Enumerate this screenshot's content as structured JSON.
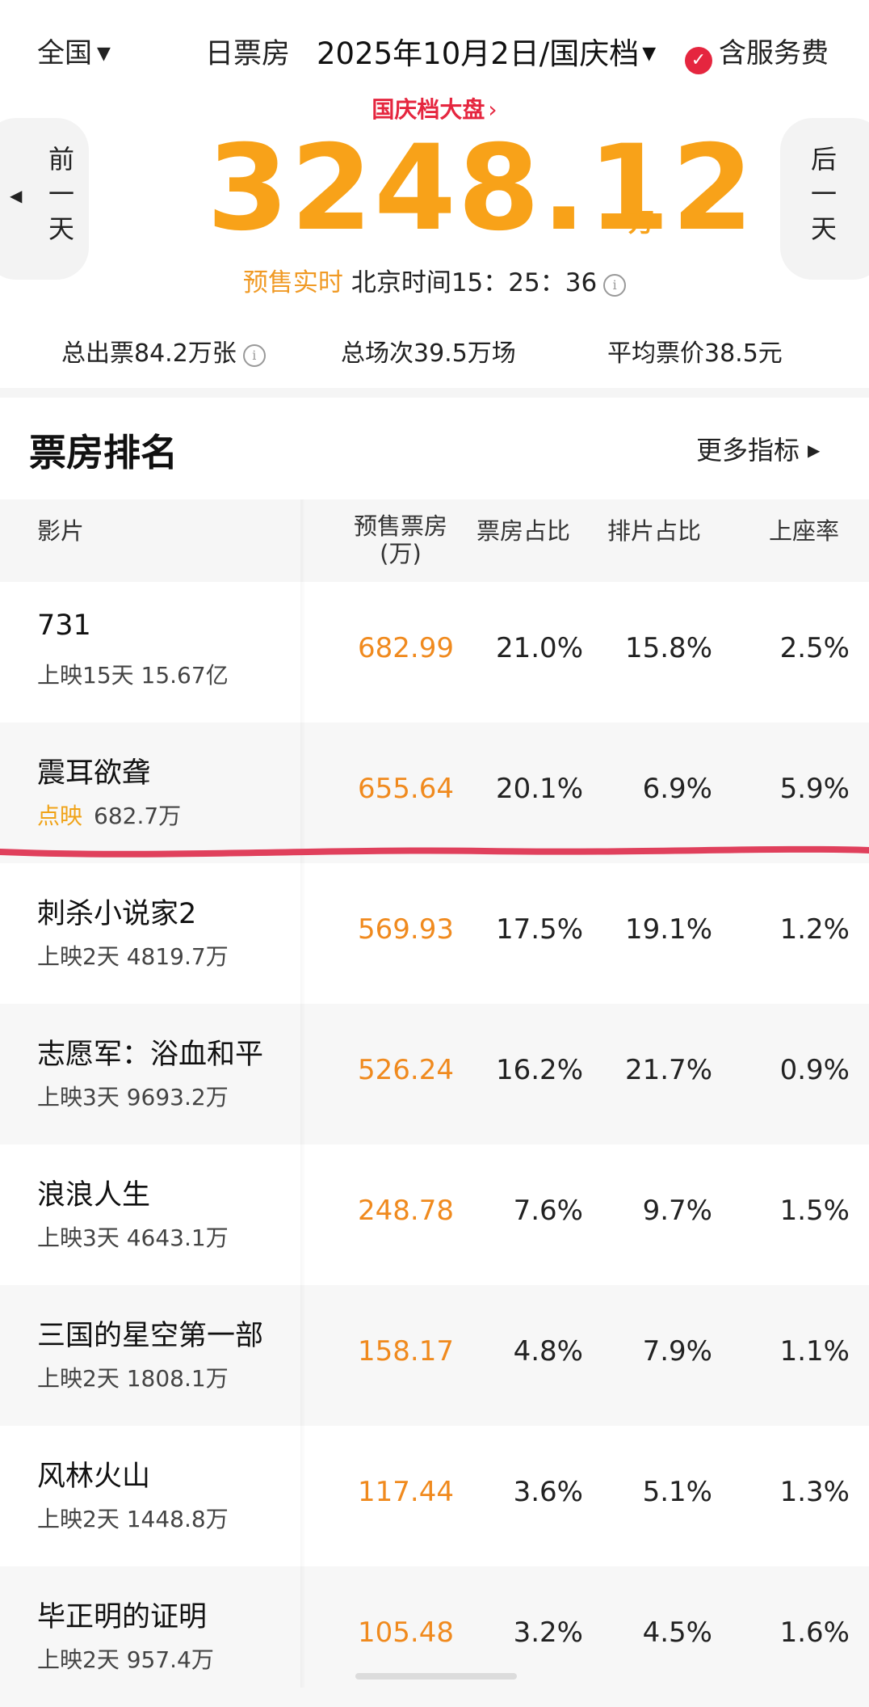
{
  "topbar": {
    "region": "全国",
    "daily_label": "日票房",
    "date": "2025年10月2日/国庆档",
    "service_fee": "含服务费"
  },
  "hero": {
    "holiday_link": "国庆档大盘",
    "prev_day": "前一天",
    "next_day": "后一天",
    "total": "3248.12",
    "unit": "万",
    "presale_label": "预售实时",
    "beijing_time": "北京时间15：25：36"
  },
  "stats": {
    "tickets": "总出票84.2万张",
    "shows": "总场次39.5万场",
    "avg_price": "平均票价38.5元"
  },
  "ranking": {
    "title": "票房排名",
    "more": "更多指标"
  },
  "table": {
    "headers": {
      "film": "影片",
      "presale": "预售票房",
      "presale_unit": "(万)",
      "share": "票房占比",
      "schedule": "排片占比",
      "seat": "上座率"
    },
    "rows": [
      {
        "title": "731",
        "tag": "",
        "sub": "上映15天  15.67亿",
        "presale": "682.99",
        "share": "21.0%",
        "schedule": "15.8%",
        "seat": "2.5%"
      },
      {
        "title": "震耳欲聋",
        "tag": "点映",
        "sub": "682.7万",
        "presale": "655.64",
        "share": "20.1%",
        "schedule": "6.9%",
        "seat": "5.9%"
      },
      {
        "title": "刺杀小说家2",
        "tag": "",
        "sub": "上映2天  4819.7万",
        "presale": "569.93",
        "share": "17.5%",
        "schedule": "19.1%",
        "seat": "1.2%"
      },
      {
        "title": "志愿军：浴血和平",
        "tag": "",
        "sub": "上映3天  9693.2万",
        "presale": "526.24",
        "share": "16.2%",
        "schedule": "21.7%",
        "seat": "0.9%"
      },
      {
        "title": "浪浪人生",
        "tag": "",
        "sub": "上映3天  4643.1万",
        "presale": "248.78",
        "share": "7.6%",
        "schedule": "9.7%",
        "seat": "1.5%"
      },
      {
        "title": "三国的星空第一部",
        "tag": "",
        "sub": "上映2天  1808.1万",
        "presale": "158.17",
        "share": "4.8%",
        "schedule": "7.9%",
        "seat": "1.1%"
      },
      {
        "title": "风林火山",
        "tag": "",
        "sub": "上映2天  1448.8万",
        "presale": "117.44",
        "share": "3.6%",
        "schedule": "5.1%",
        "seat": "1.3%"
      },
      {
        "title": "毕正明的证明",
        "tag": "",
        "sub": "上映2天  957.4万",
        "presale": "105.48",
        "share": "3.2%",
        "schedule": "4.5%",
        "seat": "1.6%"
      }
    ]
  },
  "colors": {
    "accent_orange": "#f8a219",
    "brand_red": "#e5263f",
    "annotation_line": "#e0405c"
  }
}
